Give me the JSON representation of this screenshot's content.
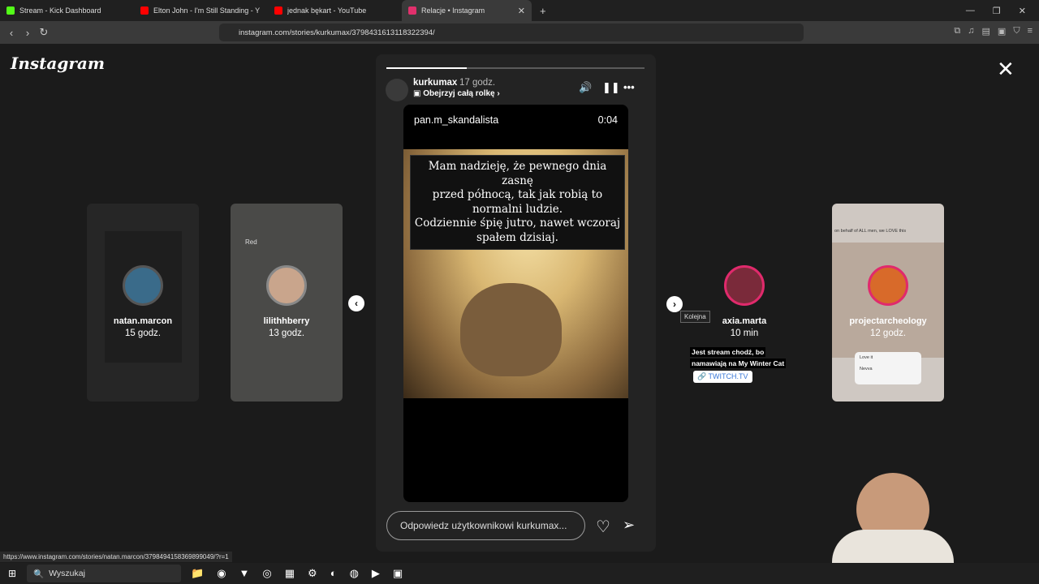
{
  "browser": {
    "tabs": [
      {
        "label": "Stream - Kick Dashboard",
        "favicon_color": "#53fc18"
      },
      {
        "label": "Elton John - I'm Still Standing - Y",
        "favicon_color": "#ff0000"
      },
      {
        "label": "jednak bękart - YouTube",
        "favicon_color": "#ff0000"
      },
      {
        "label": "Relacje • Instagram",
        "favicon_color": "#e1306c",
        "active": true
      }
    ],
    "url": "instagram.com/stories/kurkumax/3798431613118322394/",
    "status_url": "https://www.instagram.com/stories/natan.marcon/3798494158369899049/?r=1"
  },
  "instagram": {
    "logo": "Instagram",
    "story": {
      "progress": 0.31,
      "username": "kurkumax",
      "time": "17 godz.",
      "reel_link": "Obejrzyj całą rolkę",
      "video_user": "pan.m_skandalista",
      "video_time": "0:04",
      "caption_lines": [
        "Mam nadzieję, że pewnego dnia zasnę",
        "przed północą, tak jak robią to",
        "normalni ludzie.",
        "Codziennie śpię jutro, nawet wczoraj",
        "spałem dzisiaj."
      ],
      "reply_placeholder": "Odpowiedz użytkownikowi kurkumax..."
    },
    "side_stories": [
      {
        "name": "natan.marcon",
        "time": "15 godz."
      },
      {
        "name": "lilithhberry",
        "time": "13 godz.",
        "tag": "Red"
      },
      {
        "name": "axia.marta",
        "time": "10 min",
        "overlay": [
          "Jest stream chodź, bo",
          "namawiają na My Winter Cat"
        ],
        "link": "TWITCH.TV"
      },
      {
        "name": "projectarcheology",
        "time": "12 godz.",
        "header": "on behalf of ALL men, we LOVE this",
        "poll": [
          "Love it",
          "Nevva"
        ]
      }
    ],
    "next_tooltip": "Kolejna"
  },
  "taskbar": {
    "search": "Wyszukaj"
  }
}
